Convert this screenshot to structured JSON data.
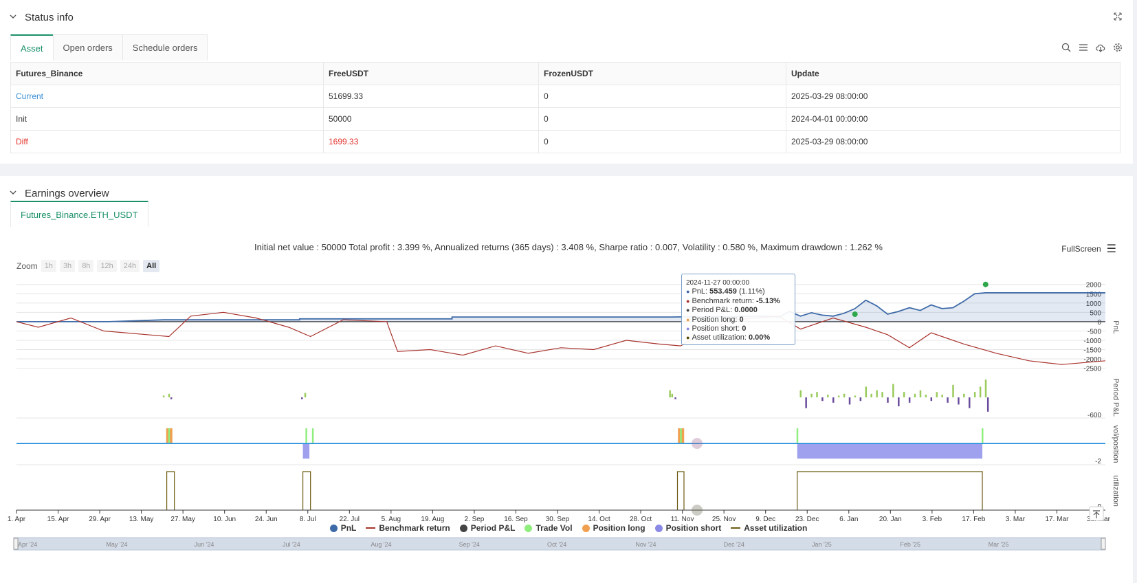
{
  "status_panel": {
    "title": "Status info",
    "tabs": [
      {
        "label": "Asset"
      },
      {
        "label": "Open orders"
      },
      {
        "label": "Schedule orders"
      }
    ],
    "table": {
      "headers": [
        "Futures_Binance",
        "FreeUSDT",
        "FrozenUSDT",
        "Update"
      ],
      "rows": [
        {
          "name": "Current",
          "free": "51699.33",
          "frozen": "0",
          "update": "2025-03-29 08:00:00"
        },
        {
          "name": "Init",
          "free": "50000",
          "frozen": "0",
          "update": "2024-04-01 00:00:00"
        },
        {
          "name": "Diff",
          "free": "1699.33",
          "frozen": "0",
          "update": "2025-03-29 08:00:00"
        }
      ]
    },
    "icons": [
      "search-icon",
      "list-icon",
      "cloud-download-icon",
      "gear-icon"
    ]
  },
  "earnings_panel": {
    "title": "Earnings overview",
    "tab": "Futures_Binance.ETH_USDT",
    "summary": "Initial net value : 50000 Total profit : 3.399 %, Annualized returns (365 days) : 3.408 %, Sharpe ratio : 0.007, Volatility : 0.580 %, Maximum drawdown : 1.262 %",
    "fullscreen_label": "FullScreen",
    "zoom": {
      "label": "Zoom",
      "buttons": [
        "1h",
        "3h",
        "8h",
        "12h",
        "24h",
        "All"
      ],
      "selected": "All"
    },
    "tooltip": {
      "date": "2024-11-27 00:00:00",
      "rows": [
        {
          "label": "PnL: ",
          "value": "553.459",
          "extra": " (1.11%)",
          "color": "#3e6aa8"
        },
        {
          "label": "Benchmark return: ",
          "value": "-5.13%",
          "extra": "",
          "color": "#a8322c"
        },
        {
          "label": "Period P&L: ",
          "value": "0.0000",
          "extra": "",
          "color": "#444444"
        },
        {
          "label": "Position long: ",
          "value": "0",
          "extra": "",
          "color": "#f0a050"
        },
        {
          "label": "Position short: ",
          "value": "0",
          "extra": "",
          "color": "#8a8ae6"
        },
        {
          "label": "Asset utilization: ",
          "value": "0.00%",
          "extra": "",
          "color": "#5a4a00"
        }
      ]
    },
    "legend": [
      {
        "label": "PnL",
        "kind": "dot",
        "color": "#3e6aa8"
      },
      {
        "label": "Benchmark return",
        "kind": "line",
        "color": "#a8322c"
      },
      {
        "label": "Period P&L",
        "kind": "dot",
        "color": "#444444"
      },
      {
        "label": "Trade Vol",
        "kind": "dot",
        "color": "#90ee7e"
      },
      {
        "label": "Position long",
        "kind": "dot",
        "color": "#f0a050"
      },
      {
        "label": "Position short",
        "kind": "dot",
        "color": "#8a8ae6"
      },
      {
        "label": "Asset utilization",
        "kind": "line",
        "color": "#6b5a10"
      }
    ]
  },
  "chart_data": {
    "type": "line",
    "x_ticks": [
      "1. Apr",
      "15. Apr",
      "29. Apr",
      "13. May",
      "27. May",
      "10. Jun",
      "24. Jun",
      "8. Jul",
      "22. Jul",
      "5. Aug",
      "19. Aug",
      "2. Sep",
      "16. Sep",
      "30. Sep",
      "14. Oct",
      "28. Oct",
      "11. Nov",
      "25. Nov",
      "9. Dec",
      "23. Dec",
      "6. Jan",
      "20. Jan",
      "3. Feb",
      "17. Feb",
      "3. Mar",
      "17. Mar",
      "31. Mar"
    ],
    "navigator_ticks": [
      "Apr '24",
      "May '24",
      "Jun '24",
      "Jul '24",
      "Aug '24",
      "Sep '24",
      "Oct '24",
      "Nov '24",
      "Dec '24",
      "Jan '25",
      "Feb '25",
      "Mar '25"
    ],
    "panes": [
      {
        "name": "PnL",
        "ylabel": "PnL",
        "y_ticks": [
          "2000",
          "1500",
          "1000",
          "500",
          "0",
          "-500",
          "-1000",
          "-1500",
          "-2000",
          "-2500"
        ],
        "ylim": [
          -2700,
          2100
        ]
      },
      {
        "name": "Period P&L",
        "ylabel": "Period P&L",
        "y_ticks": [
          "-600"
        ]
      },
      {
        "name": "vol/position",
        "ylabel": "vol/position",
        "y_ticks": [
          "-2"
        ]
      },
      {
        "name": "utilization",
        "ylabel": "utilization",
        "y_ticks": [
          "0"
        ]
      }
    ],
    "series": [
      {
        "name": "PnL",
        "x": [
          0,
          0.085,
          0.135,
          0.26,
          0.26,
          0.4,
          0.4,
          0.6,
          0.69,
          0.7,
          0.71,
          0.72,
          0.73,
          0.74,
          0.75,
          0.76,
          0.77,
          0.78,
          0.79,
          0.8,
          0.81,
          0.82,
          0.83,
          0.84,
          0.85,
          0.86,
          0.87,
          0.88,
          0.89,
          1.0
        ],
        "values": [
          0,
          0,
          100,
          100,
          150,
          150,
          250,
          250,
          300,
          250,
          550,
          300,
          480,
          350,
          300,
          450,
          700,
          1150,
          850,
          400,
          550,
          750,
          600,
          900,
          700,
          750,
          1100,
          1500,
          1550,
          1550
        ]
      },
      {
        "name": "Benchmark return",
        "x": [
          0,
          0.02,
          0.05,
          0.08,
          0.12,
          0.14,
          0.16,
          0.19,
          0.22,
          0.25,
          0.27,
          0.3,
          0.34,
          0.35,
          0.38,
          0.41,
          0.44,
          0.47,
          0.5,
          0.53,
          0.56,
          0.59,
          0.61,
          0.63,
          0.66,
          0.7,
          0.72,
          0.75,
          0.78,
          0.8,
          0.82,
          0.84,
          0.85,
          0.87,
          0.9,
          0.93,
          0.96,
          1.0
        ],
        "values": [
          0,
          -300,
          200,
          -500,
          -700,
          -800,
          300,
          500,
          200,
          -300,
          -800,
          100,
          0,
          -1600,
          -1500,
          -1800,
          -1300,
          -1700,
          -1400,
          -1500,
          -1000,
          -1200,
          -1300,
          -600,
          100,
          300,
          -400,
          200,
          -300,
          -700,
          -1400,
          -600,
          -800,
          -1200,
          -1700,
          -2100,
          -2300,
          -2100
        ]
      }
    ],
    "period_pnl_bars": [
      {
        "x": 0.135,
        "v": 20
      },
      {
        "x": 0.14,
        "v": 40
      },
      {
        "x": 0.142,
        "v": -20
      },
      {
        "x": 0.262,
        "v": -20
      },
      {
        "x": 0.265,
        "v": 50
      },
      {
        "x": 0.6,
        "v": 80
      },
      {
        "x": 0.602,
        "v": 40
      },
      {
        "x": 0.605,
        "v": -20
      },
      {
        "x": 0.72,
        "v": 80
      },
      {
        "x": 0.725,
        "v": -120
      },
      {
        "x": 0.73,
        "v": 40
      },
      {
        "x": 0.735,
        "v": 60
      },
      {
        "x": 0.74,
        "v": -40
      },
      {
        "x": 0.745,
        "v": 30
      },
      {
        "x": 0.75,
        "v": -60
      },
      {
        "x": 0.755,
        "v": 20
      },
      {
        "x": 0.76,
        "v": 40
      },
      {
        "x": 0.765,
        "v": -80
      },
      {
        "x": 0.77,
        "v": 20
      },
      {
        "x": 0.775,
        "v": -40
      },
      {
        "x": 0.78,
        "v": 120
      },
      {
        "x": 0.785,
        "v": 40
      },
      {
        "x": 0.79,
        "v": 80
      },
      {
        "x": 0.795,
        "v": 60
      },
      {
        "x": 0.8,
        "v": -60
      },
      {
        "x": 0.805,
        "v": 150
      },
      {
        "x": 0.81,
        "v": -100
      },
      {
        "x": 0.815,
        "v": 60
      },
      {
        "x": 0.82,
        "v": -60
      },
      {
        "x": 0.825,
        "v": 40
      },
      {
        "x": 0.83,
        "v": 80
      },
      {
        "x": 0.835,
        "v": 30
      },
      {
        "x": 0.84,
        "v": -40
      },
      {
        "x": 0.845,
        "v": 60
      },
      {
        "x": 0.85,
        "v": 30
      },
      {
        "x": 0.855,
        "v": -60
      },
      {
        "x": 0.86,
        "v": 140
      },
      {
        "x": 0.865,
        "v": -80
      },
      {
        "x": 0.87,
        "v": 40
      },
      {
        "x": 0.875,
        "v": -120
      },
      {
        "x": 0.88,
        "v": 60
      },
      {
        "x": 0.885,
        "v": 120
      },
      {
        "x": 0.89,
        "v": 200
      },
      {
        "x": 0.892,
        "v": -160
      }
    ],
    "trade_vol_x": [
      0.14,
      0.266,
      0.272,
      0.61,
      0.717,
      0.887
    ],
    "position_long_x": [
      0.14,
      0.61
    ],
    "position_short": [
      {
        "x0": 0.263,
        "x1": 0.269
      },
      {
        "x0": 0.717,
        "x1": 0.887
      }
    ],
    "utilization_blocks": [
      {
        "x0": 0.138,
        "x1": 0.145
      },
      {
        "x0": 0.263,
        "x1": 0.27
      },
      {
        "x0": 0.607,
        "x1": 0.613
      },
      {
        "x0": 0.717,
        "x1": 0.887
      }
    ]
  }
}
